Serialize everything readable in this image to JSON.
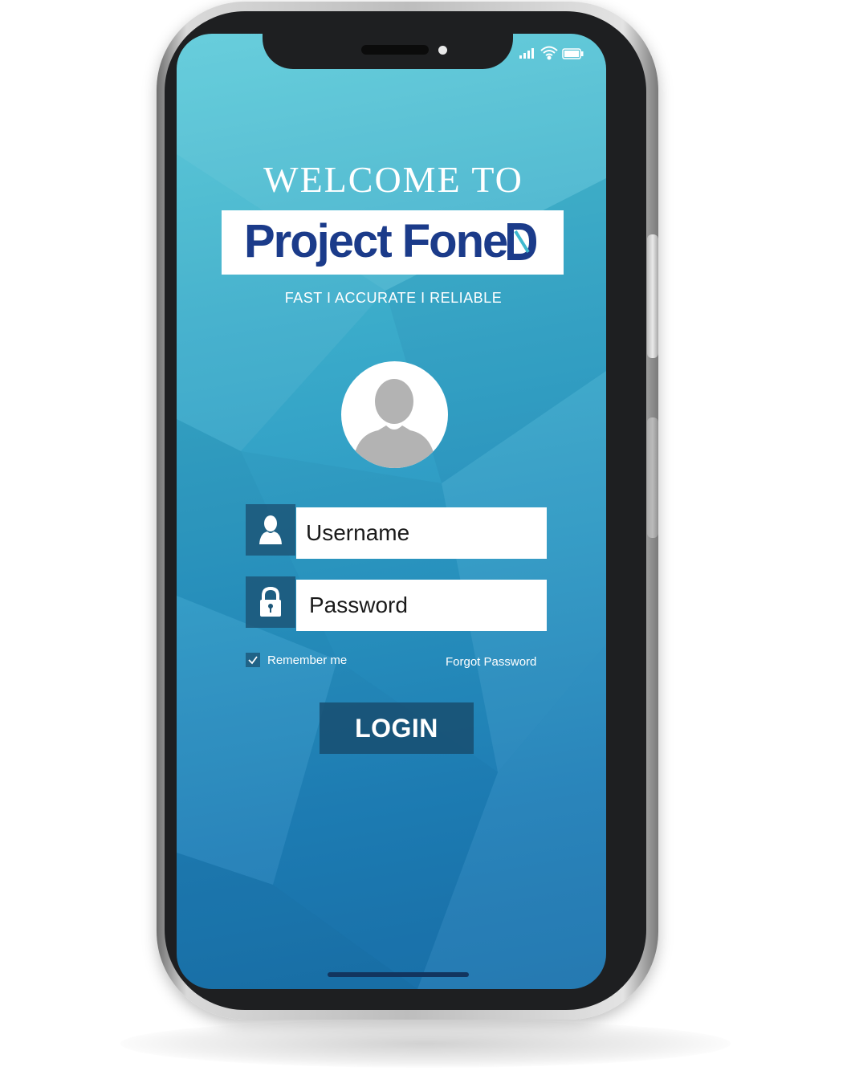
{
  "screen": {
    "welcome_text": "WELCOME TO",
    "logo": {
      "brand": "Project Fone",
      "letter": "D"
    },
    "tagline": "FAST  I  ACCURATE  I  RELIABLE"
  },
  "form": {
    "username_placeholder": "Username",
    "password_placeholder": "Password",
    "remember_label": "Remember me",
    "remember_checked": true,
    "forgot_label": "Forgot Password",
    "login_label": "LOGIN"
  },
  "icons": {
    "avatar": "user-avatar-icon",
    "username": "user-icon",
    "password": "lock-icon",
    "checkbox": "checkmark-icon",
    "status": [
      "signal-icon",
      "wifi-icon",
      "battery-icon"
    ]
  },
  "colors": {
    "gradient_top": "#57c9d8",
    "gradient_bottom": "#1a72ad",
    "brand_blue": "#1b3b8a",
    "field_icon_bg": "#1c5678"
  }
}
